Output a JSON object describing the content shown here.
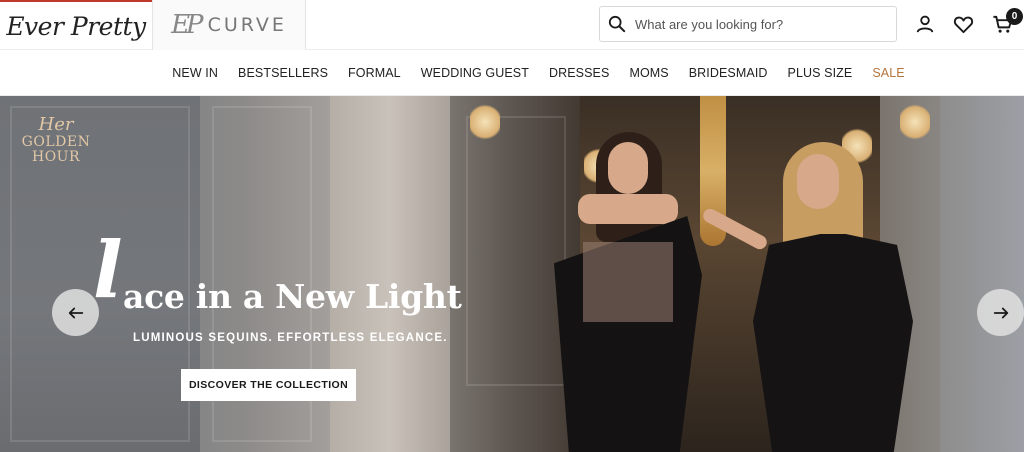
{
  "header": {
    "brand_logo": "Ever Pretty",
    "curve_monogram": "EP",
    "curve_label": "CURVE",
    "search_placeholder": "What are you looking for?",
    "cart_count": "0",
    "accent_color": "#c0392b",
    "icons": [
      "search-icon",
      "account-icon",
      "wishlist-icon",
      "cart-icon"
    ]
  },
  "nav": {
    "items": [
      "NEW IN",
      "BESTSELLERS",
      "FORMAL",
      "WEDDING GUEST",
      "DRESSES",
      "MOMS",
      "BRIDESMAID",
      "PLUS SIZE",
      "SALE"
    ],
    "sale_color": "#b5753c"
  },
  "hero": {
    "badge_her": "Her",
    "badge_golden_hour": "GOLDEN HOUR",
    "title_initial": "l",
    "title_rest": "ace in a New Light",
    "subtitle": "LUMINOUS SEQUINS. EFFORTLESS ELEGANCE.",
    "cta_label": "DISCOVER THE COLLECTION",
    "icons": [
      "arrow-left-icon",
      "arrow-right-icon"
    ]
  }
}
